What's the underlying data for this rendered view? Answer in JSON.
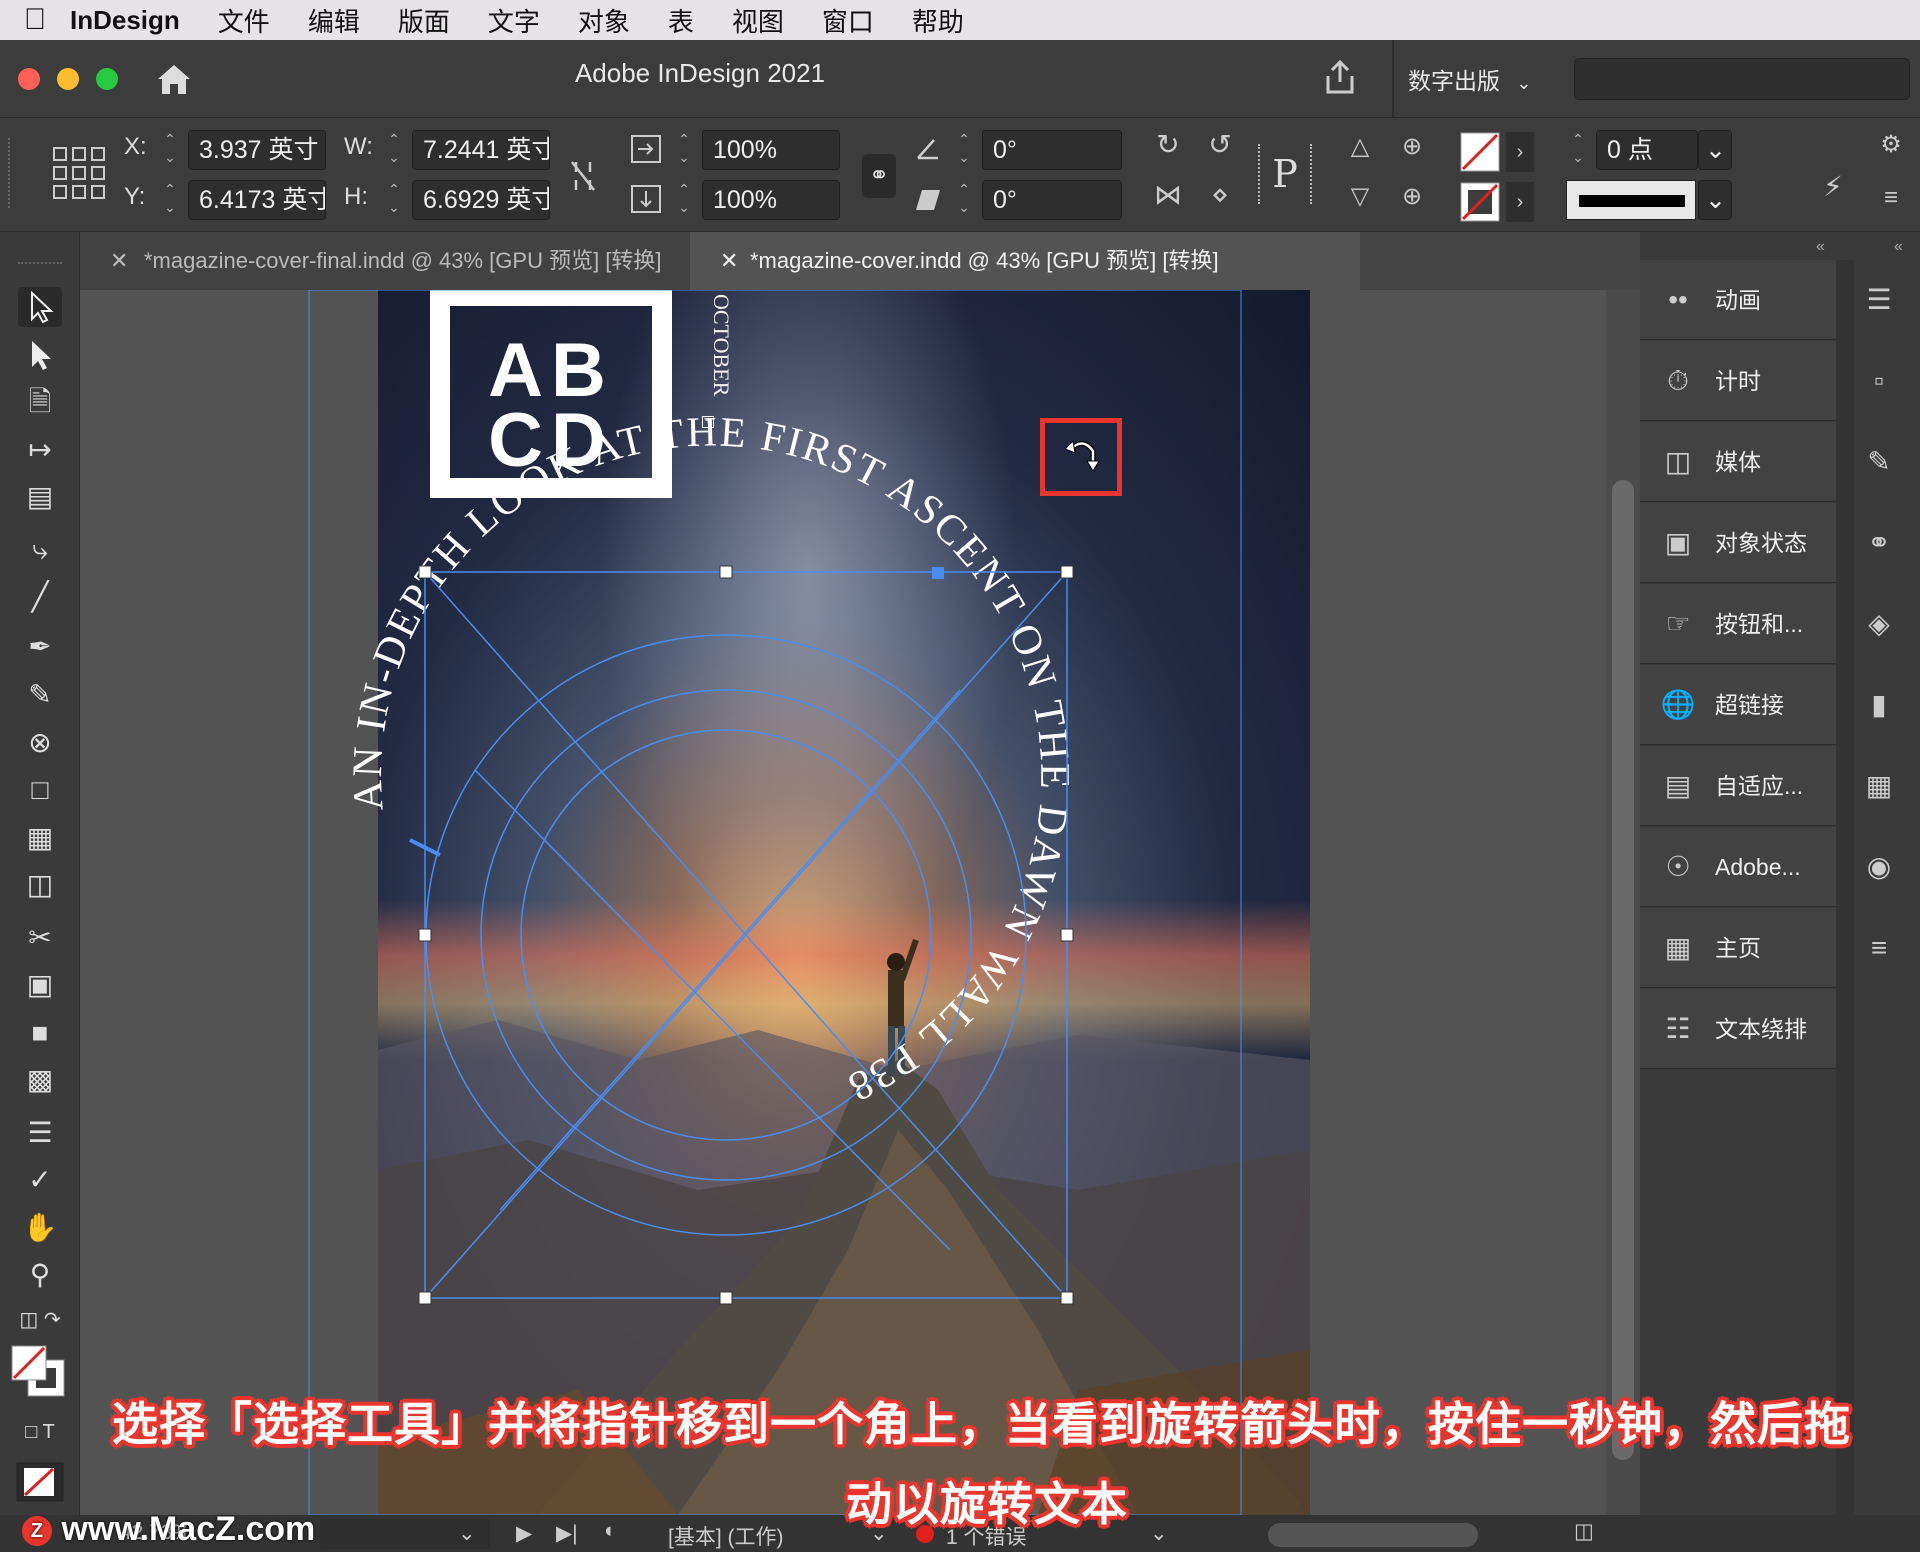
{
  "menubar": {
    "app": "InDesign",
    "items": [
      "文件",
      "编辑",
      "版面",
      "文字",
      "对象",
      "表",
      "视图",
      "窗口",
      "帮助"
    ]
  },
  "window": {
    "title": "Adobe InDesign 2021",
    "workspace": "数字出版"
  },
  "control": {
    "x_label": "X:",
    "x_value": "3.937 英寸",
    "y_label": "Y:",
    "y_value": "6.4173 英寸",
    "w_label": "W:",
    "w_value": "7.2441 英寸",
    "h_label": "H:",
    "h_value": "6.6929 英寸",
    "scale_x": "100%",
    "scale_y": "100%",
    "rotate": "0°",
    "shear": "0°",
    "stroke_weight": "0 点"
  },
  "tabs": [
    {
      "label": "*magazine-cover-final.indd @ 43% [GPU 预览] [转换]",
      "active": false
    },
    {
      "label": "*magazine-cover.indd @ 43% [GPU 预览] [转换]",
      "active": true
    }
  ],
  "document": {
    "logo_line1": "AB",
    "logo_line2": "CD",
    "month": "OCTOBER",
    "arc_text": "AN IN-DEPTH LOOK AT THE FIRST ASCENT ON THE DAWN WALL P38"
  },
  "panels": [
    {
      "label": "动画",
      "icon": "animation-icon"
    },
    {
      "label": "计时",
      "icon": "timing-icon"
    },
    {
      "label": "媒体",
      "icon": "media-icon"
    },
    {
      "label": "对象状态",
      "icon": "object-states-icon"
    },
    {
      "label": "按钮和...",
      "icon": "buttons-icon"
    },
    {
      "label": "超链接",
      "icon": "hyperlinks-icon"
    },
    {
      "label": "自适应...",
      "icon": "liquid-layout-icon"
    },
    {
      "label": "Adobe...",
      "icon": "adobe-cc-icon"
    },
    {
      "label": "主页",
      "icon": "pages-icon"
    },
    {
      "label": "文本绕排",
      "icon": "text-wrap-icon"
    }
  ],
  "status": {
    "zoom": "42.73%",
    "profile": "[基本] (工作)",
    "errors": "1 个错误"
  },
  "caption": {
    "line1": "选择「选择工具」并将指针移到一个角上，当看到旋转箭头时，按住一秒钟，然后拖",
    "line2": "动以旋转文本"
  },
  "watermark": "www.MacZ.com",
  "colors": {
    "highlight_box": "#e9352e",
    "selection": "#4a8df0"
  }
}
